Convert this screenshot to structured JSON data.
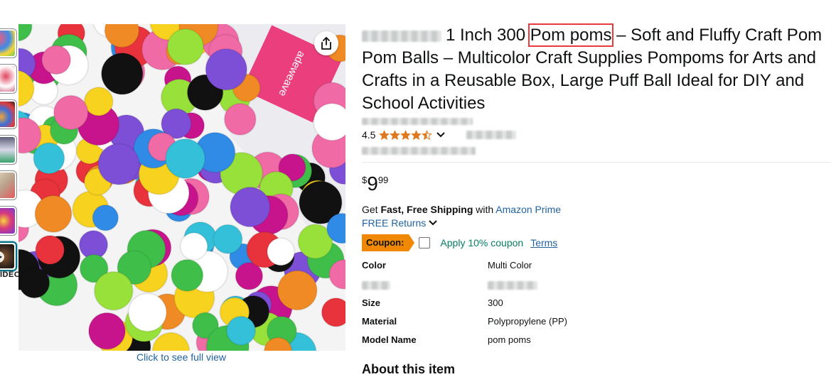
{
  "thumbnails": [
    {
      "name": "thumb-1",
      "color": "#f25a7c"
    },
    {
      "name": "thumb-2",
      "color": "#e0465f"
    },
    {
      "name": "thumb-3",
      "color": "#3d6fd8"
    },
    {
      "name": "thumb-4",
      "color": "#5e5e7a"
    },
    {
      "name": "thumb-5",
      "color": "#b9a48e"
    },
    {
      "name": "thumb-6",
      "color": "#d83a7a"
    },
    {
      "name": "thumb-7",
      "color": "#3a2a20"
    }
  ],
  "video_label": "IDEO",
  "main_image": {
    "alt": "Colorful pom poms spilling from a bag",
    "brand_text": "adeweave"
  },
  "see_full_view": "Click to see full view",
  "title_text": "1 Inch 300 ",
  "title_highlight": "Pom poms",
  "title_rest": " – Soft and Fluffy Craft Pom Pom Balls – Multicolor Craft Supplies Pompoms for Arts and Crafts in a Reusable Box, Large Puff Ball Ideal for DIY and School Activities",
  "rating": {
    "value": "4.5",
    "stars": 4.5
  },
  "price": {
    "symbol": "$",
    "whole": "9",
    "fraction": "99"
  },
  "shipping": {
    "prefix": "Get ",
    "bold": "Fast, Free Shipping",
    "middle": " with ",
    "link": "Amazon Prime"
  },
  "returns": "FREE Returns",
  "coupon": {
    "badge": "Coupon:",
    "apply": "Apply 10% coupon",
    "terms": "Terms"
  },
  "specs": [
    {
      "key": "Color",
      "value": "Multi Color"
    },
    {
      "key": "",
      "value": ""
    },
    {
      "key": "Size",
      "value": "300"
    },
    {
      "key": "Material",
      "value": "Polypropylene (PP)"
    },
    {
      "key": "Model Name",
      "value": "pom poms"
    }
  ],
  "about": "About this item",
  "colors": {
    "link": "#2162a1",
    "coupon": "#f08804",
    "apply": "#067d62",
    "star": "#de7921",
    "highlight": "#e83b3b"
  }
}
